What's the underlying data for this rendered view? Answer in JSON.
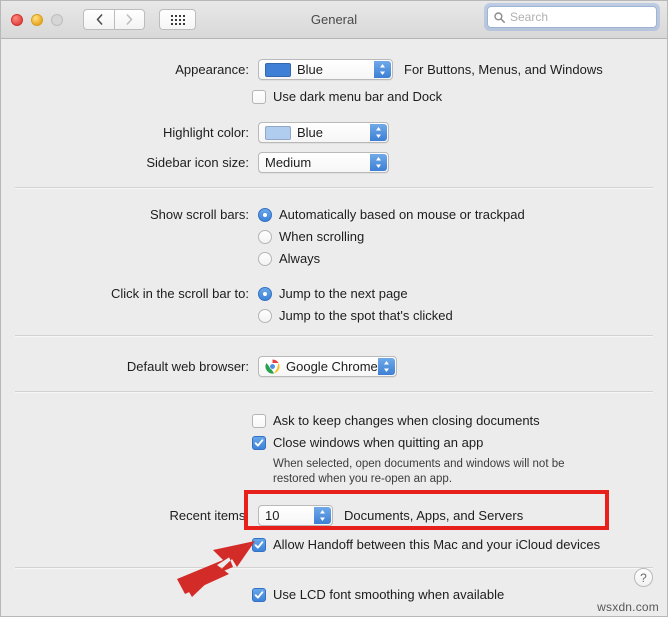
{
  "window": {
    "title": "General",
    "traffic_lights": [
      "close",
      "minimize",
      "zoom-disabled"
    ],
    "nav_back": "‹",
    "nav_forward": "›",
    "show_all_icon": "grid-icon"
  },
  "search": {
    "placeholder": "Search",
    "value": "",
    "icon": "search-icon"
  },
  "sections": {
    "appearance": {
      "label": "Appearance:",
      "value": "Blue",
      "swatch_color": "#3f7fd6",
      "hint": "For Buttons, Menus, and Windows",
      "dark_menu_checkbox": {
        "label": "Use dark menu bar and Dock",
        "checked": false
      }
    },
    "highlight": {
      "label": "Highlight color:",
      "value": "Blue",
      "swatch_color": "#b0cdf0"
    },
    "sidebar_icon_size": {
      "label": "Sidebar icon size:",
      "value": "Medium"
    },
    "scroll_bars": {
      "label": "Show scroll bars:",
      "options": [
        {
          "label": "Automatically based on mouse or trackpad",
          "selected": true
        },
        {
          "label": "When scrolling",
          "selected": false
        },
        {
          "label": "Always",
          "selected": false
        }
      ]
    },
    "click_scroll_bar": {
      "label": "Click in the scroll bar to:",
      "options": [
        {
          "label": "Jump to the next page",
          "selected": true
        },
        {
          "label": "Jump to the spot that's clicked",
          "selected": false
        }
      ]
    },
    "default_browser": {
      "label": "Default web browser:",
      "value": "Google Chrome",
      "icon": "chrome-icon"
    },
    "documents": {
      "ask_keep_changes": {
        "label": "Ask to keep changes when closing documents",
        "checked": false
      },
      "close_windows": {
        "label": "Close windows when quitting an app",
        "checked": true
      },
      "close_windows_note_line1": "When selected, open documents and windows will not be",
      "close_windows_note_line2": "restored when you re-open an app."
    },
    "recent_items": {
      "label": "Recent items:",
      "value": "10",
      "hint": "Documents, Apps, and Servers"
    },
    "handoff": {
      "label": "Allow Handoff between this Mac and your iCloud devices",
      "checked": true,
      "highlight_color": "#e8201c"
    },
    "lcd_smoothing": {
      "label": "Use LCD font smoothing when available",
      "checked": true
    }
  },
  "help": {
    "label": "?"
  },
  "watermark": {
    "text": "wsxdn.com"
  }
}
